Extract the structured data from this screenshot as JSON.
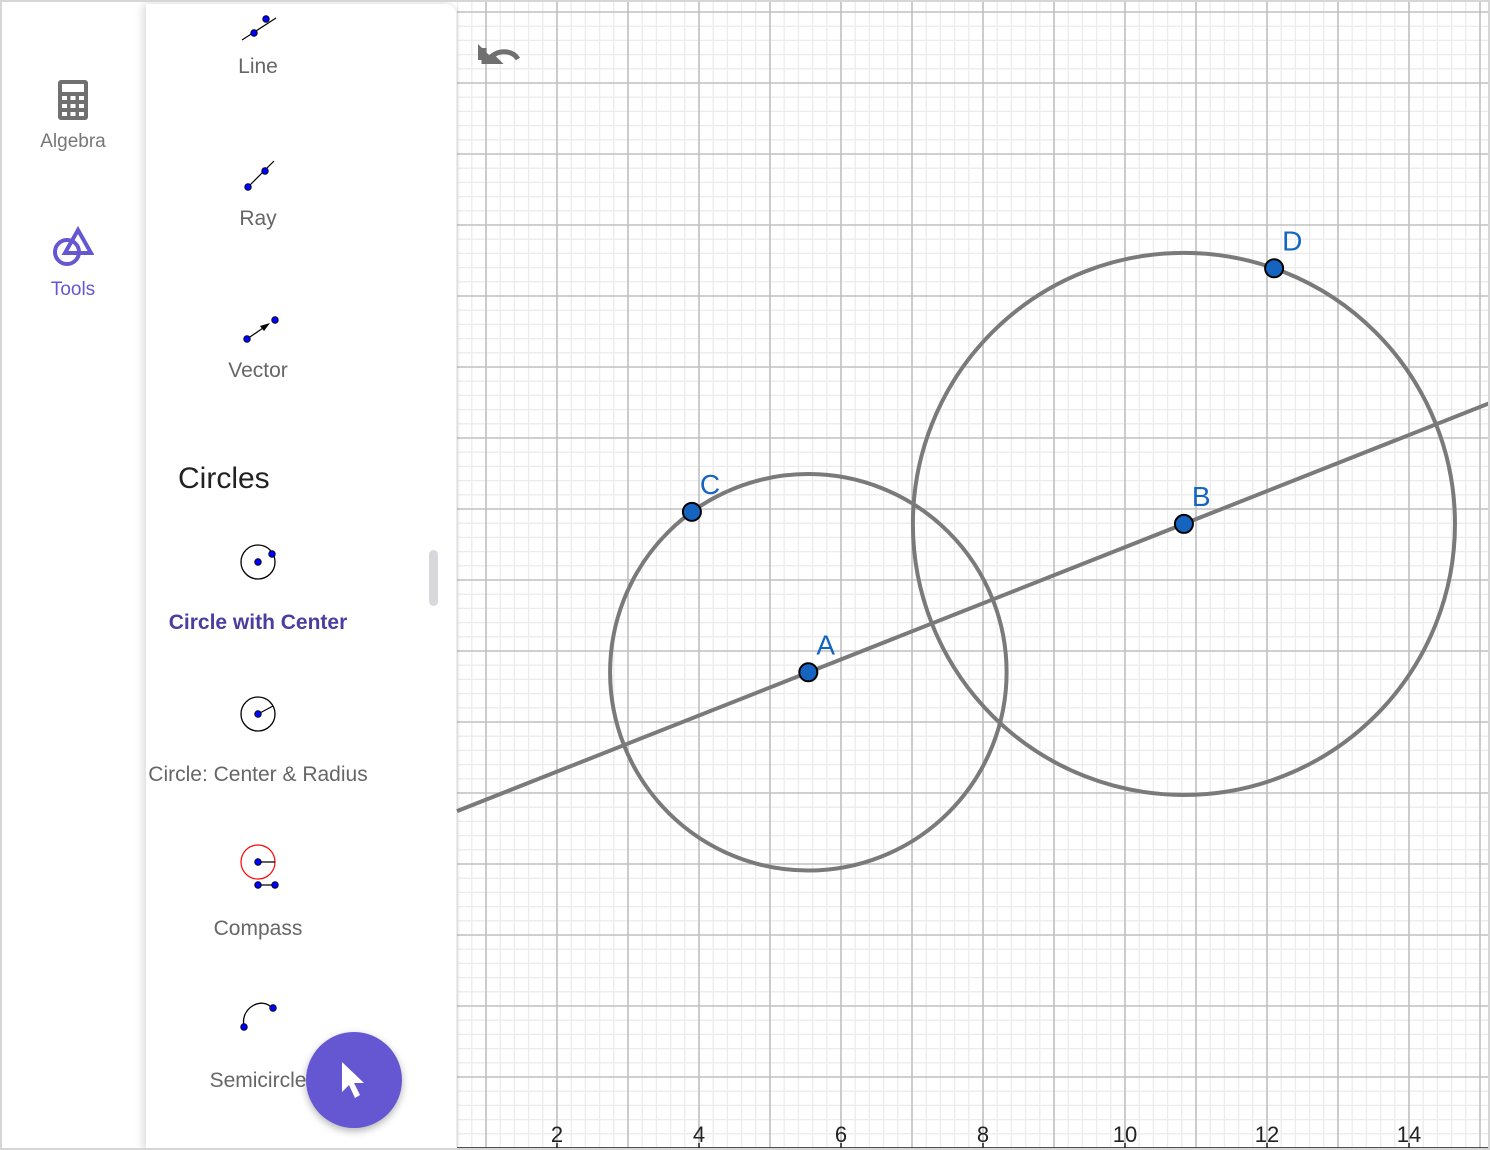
{
  "rail": {
    "items": [
      {
        "label": "Algebra",
        "icon": "calculator-icon",
        "active": false
      },
      {
        "label": "Tools",
        "icon": "tools-icon",
        "active": true
      }
    ]
  },
  "tools_panel": {
    "tools": [
      {
        "label": "Line",
        "icon": "line-icon"
      },
      {
        "label": "Ray",
        "icon": "ray-icon"
      },
      {
        "label": "Vector",
        "icon": "vector-icon"
      }
    ],
    "section_title": "Circles",
    "circle_tools": [
      {
        "label": "Circle with Center",
        "icon": "circle-with-center-icon",
        "selected": true
      },
      {
        "label": "Circle: Center & Radius",
        "icon": "circle-center-radius-icon",
        "selected": false
      },
      {
        "label": "Compass",
        "icon": "compass-icon",
        "selected": false
      },
      {
        "label": "Semicircle",
        "icon": "semicircle-icon",
        "selected": false
      }
    ]
  },
  "fab": {
    "icon": "move-cursor-icon"
  },
  "undo": {
    "icon": "undo-icon"
  },
  "graphics": {
    "x_ticks": [
      "2",
      "4",
      "6",
      "8",
      "10",
      "12",
      "14"
    ],
    "points": [
      {
        "name": "A",
        "x": 5.54,
        "y": 6.7
      },
      {
        "name": "B",
        "x": 10.83,
        "y": 8.79
      },
      {
        "name": "C",
        "x": 3.9,
        "y": 8.96
      },
      {
        "name": "D",
        "x": 12.1,
        "y": 12.39
      }
    ],
    "line_through": [
      "A",
      "B"
    ],
    "circles": [
      {
        "center": "A",
        "through": "C"
      },
      {
        "center": "B",
        "through": "D"
      }
    ],
    "colors": {
      "point": "#1565c0",
      "object": "#7a7a7a",
      "accent": "#6557d2"
    }
  }
}
